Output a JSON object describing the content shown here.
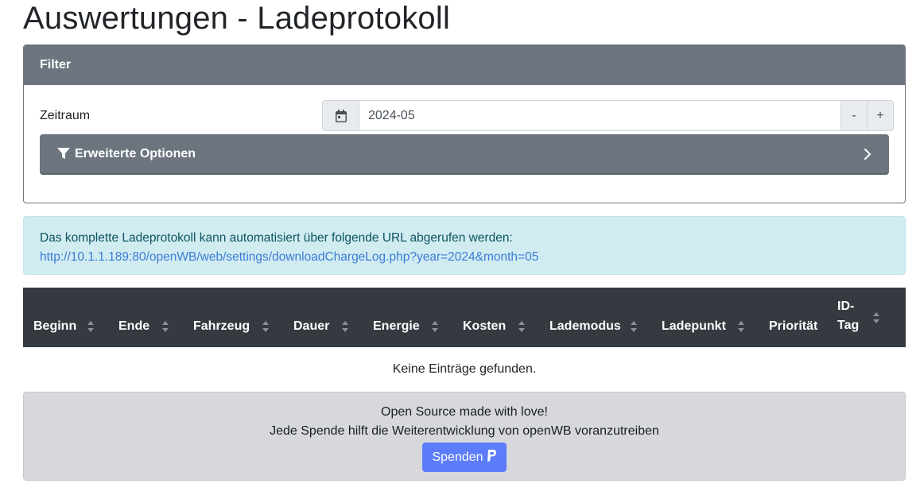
{
  "page": {
    "title": "Auswertungen - Ladeprotokoll"
  },
  "filter": {
    "header": "Filter",
    "zeitraum_label": "Zeitraum",
    "zeitraum_value": "2024-05",
    "decrement_label": "-",
    "increment_label": "+",
    "calendar_icon": "calendar-icon",
    "advanced_options_label": "Erweiterte Optionen",
    "advanced_options_icon": "filter-icon",
    "expand_icon": "chevron-right-icon"
  },
  "info": {
    "text": "Das komplette Ladeprotokoll kann automatisiert über folgende URL abgerufen werden:",
    "url": "http://10.1.1.189:80/openWB/web/settings/downloadChargeLog.php?year=2024&month=05"
  },
  "table": {
    "columns": [
      {
        "label": "Beginn",
        "sortable": true
      },
      {
        "label": "Ende",
        "sortable": true
      },
      {
        "label": "Fahrzeug",
        "sortable": true
      },
      {
        "label": "Dauer",
        "sortable": true
      },
      {
        "label": "Energie",
        "sortable": true
      },
      {
        "label": "Kosten",
        "sortable": true
      },
      {
        "label": "Lademodus",
        "sortable": true
      },
      {
        "label": "Ladepunkt",
        "sortable": true
      },
      {
        "label": "Priorität",
        "sortable": false
      },
      {
        "label": "ID-\nTag",
        "sortable": true
      }
    ],
    "empty_text": "Keine Einträge gefunden."
  },
  "footer": {
    "line1": "Open Source made with love!",
    "line2": "Jede Spende hilft die Weiterentwicklung von openWB voranzutreiben",
    "donate_label": "Spenden",
    "donate_icon": "paypal-icon"
  },
  "colors": {
    "header_gray": "#6c757d",
    "table_head": "#343a40",
    "info_bg": "#d1ecf1",
    "link": "#3c7bd6",
    "donate": "#5c7cfa"
  }
}
